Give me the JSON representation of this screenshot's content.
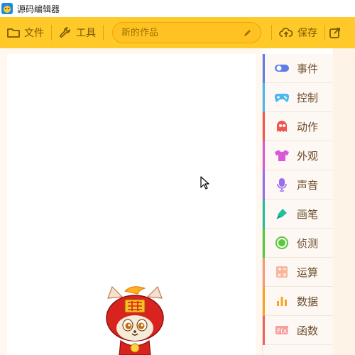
{
  "app": {
    "title": "源码编辑器"
  },
  "toolbar": {
    "file_label": "文件",
    "tools_label": "工具",
    "project_placeholder": "新的作品",
    "save_label": "保存"
  },
  "categories": [
    {
      "label": "事件",
      "icon": "toggle-icon",
      "color": "#5b7ee8"
    },
    {
      "label": "控制",
      "icon": "gamepad-icon",
      "color": "#4ab8f0"
    },
    {
      "label": "动作",
      "icon": "ghost-icon",
      "color": "#f0554f"
    },
    {
      "label": "外观",
      "icon": "shirt-icon",
      "color": "#d95ad9"
    },
    {
      "label": "声音",
      "icon": "microphone-icon",
      "color": "#9a6cf0"
    },
    {
      "label": "画笔",
      "icon": "pen-icon",
      "color": "#1fbfa0"
    },
    {
      "label": "侦测",
      "icon": "radar-icon",
      "color": "#5ac83c"
    },
    {
      "label": "运算",
      "icon": "calculator-icon",
      "color": "#f59a7a"
    },
    {
      "label": "数据",
      "icon": "bar-chart-icon",
      "color": "#f5a623"
    },
    {
      "label": "函数",
      "icon": "function-icon",
      "color": "#f06262"
    }
  ]
}
